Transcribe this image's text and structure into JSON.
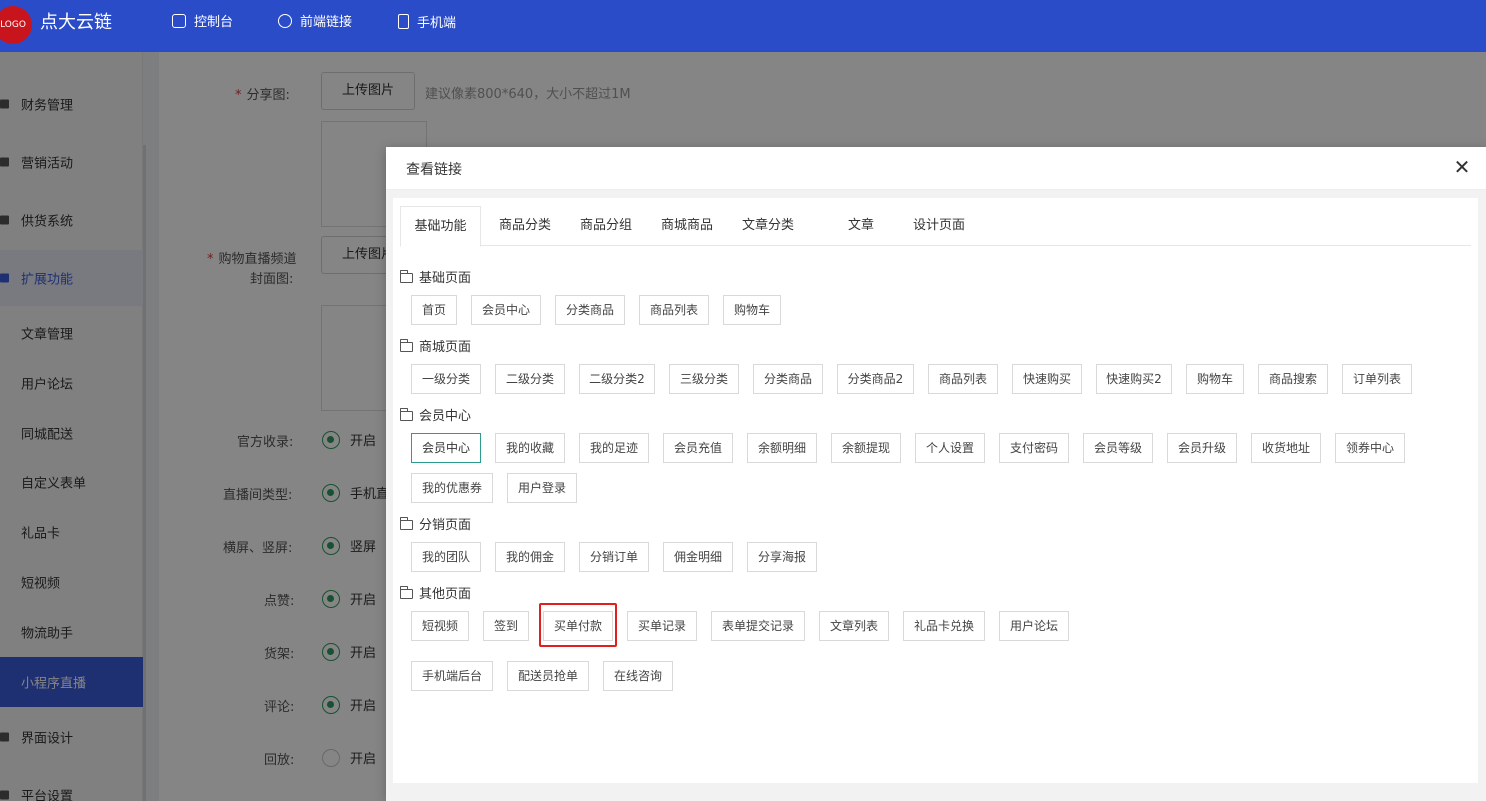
{
  "header": {
    "logo_text": "LOGO",
    "app_title": "点大云链",
    "nav": [
      {
        "label": "控制台",
        "icon": "dashboard-icon"
      },
      {
        "label": "前端链接",
        "icon": "link-icon"
      },
      {
        "label": "手机端",
        "icon": "phone-icon"
      }
    ]
  },
  "sidebar": {
    "items": [
      {
        "label": "财务管理"
      },
      {
        "label": "营销活动"
      },
      {
        "label": "供货系统"
      },
      {
        "label": "扩展功能"
      },
      {
        "label": "文章管理"
      },
      {
        "label": "用户论坛"
      },
      {
        "label": "同城配送"
      },
      {
        "label": "自定义表单"
      },
      {
        "label": "礼品卡"
      },
      {
        "label": "短视频"
      },
      {
        "label": "物流助手"
      },
      {
        "label": "小程序直播"
      },
      {
        "label": "界面设计"
      },
      {
        "label": "平台设置"
      }
    ]
  },
  "form": {
    "share_image_label": "分享图:",
    "upload_label": "上传图片",
    "share_image_hint": "建议像素800*640，大小不超过1M",
    "cover_label_line1": "购物直播频道",
    "cover_label_line2": "封面图:",
    "cover_upload_label": "上传图片",
    "rows": [
      {
        "label": "官方收录:",
        "value": "开启"
      },
      {
        "label": "直播间类型:",
        "value": "手机直"
      },
      {
        "label": "横屏、竖屏:",
        "value": "竖屏"
      },
      {
        "label": "点赞:",
        "value": "开启"
      },
      {
        "label": "货架:",
        "value": "开启"
      },
      {
        "label": "评论:",
        "value": "开启"
      },
      {
        "label": "回放:",
        "value": "开启"
      }
    ]
  },
  "modal": {
    "title": "查看链接",
    "tabs": [
      "基础功能",
      "商品分类",
      "商品分组",
      "商城商品",
      "文章分类",
      "文章",
      "设计页面"
    ],
    "active_tab": "基础功能",
    "sections": [
      {
        "title": "基础页面",
        "links": [
          "首页",
          "会员中心",
          "分类商品",
          "商品列表",
          "购物车"
        ]
      },
      {
        "title": "商城页面",
        "links": [
          "一级分类",
          "二级分类",
          "二级分类2",
          "三级分类",
          "分类商品",
          "分类商品2",
          "商品列表",
          "快速购买",
          "快速购买2",
          "购物车",
          "商品搜索",
          "订单列表"
        ]
      },
      {
        "title": "会员中心",
        "links": [
          "会员中心",
          "我的收藏",
          "我的足迹",
          "会员充值",
          "余额明细",
          "余额提现",
          "个人设置",
          "支付密码",
          "会员等级",
          "会员升级",
          "收货地址",
          "领券中心",
          "我的优惠券",
          "用户登录"
        ]
      },
      {
        "title": "分销页面",
        "links": [
          "我的团队",
          "我的佣金",
          "分销订单",
          "佣金明细",
          "分享海报"
        ]
      },
      {
        "title": "其他页面",
        "links": [
          "短视频",
          "签到",
          "买单付款",
          "买单记录",
          "表单提交记录",
          "文章列表",
          "礼品卡兑换",
          "用户论坛",
          "手机端后台",
          "配送员抢单",
          "在线咨询"
        ]
      }
    ],
    "highlighted_link": "买单付款"
  }
}
